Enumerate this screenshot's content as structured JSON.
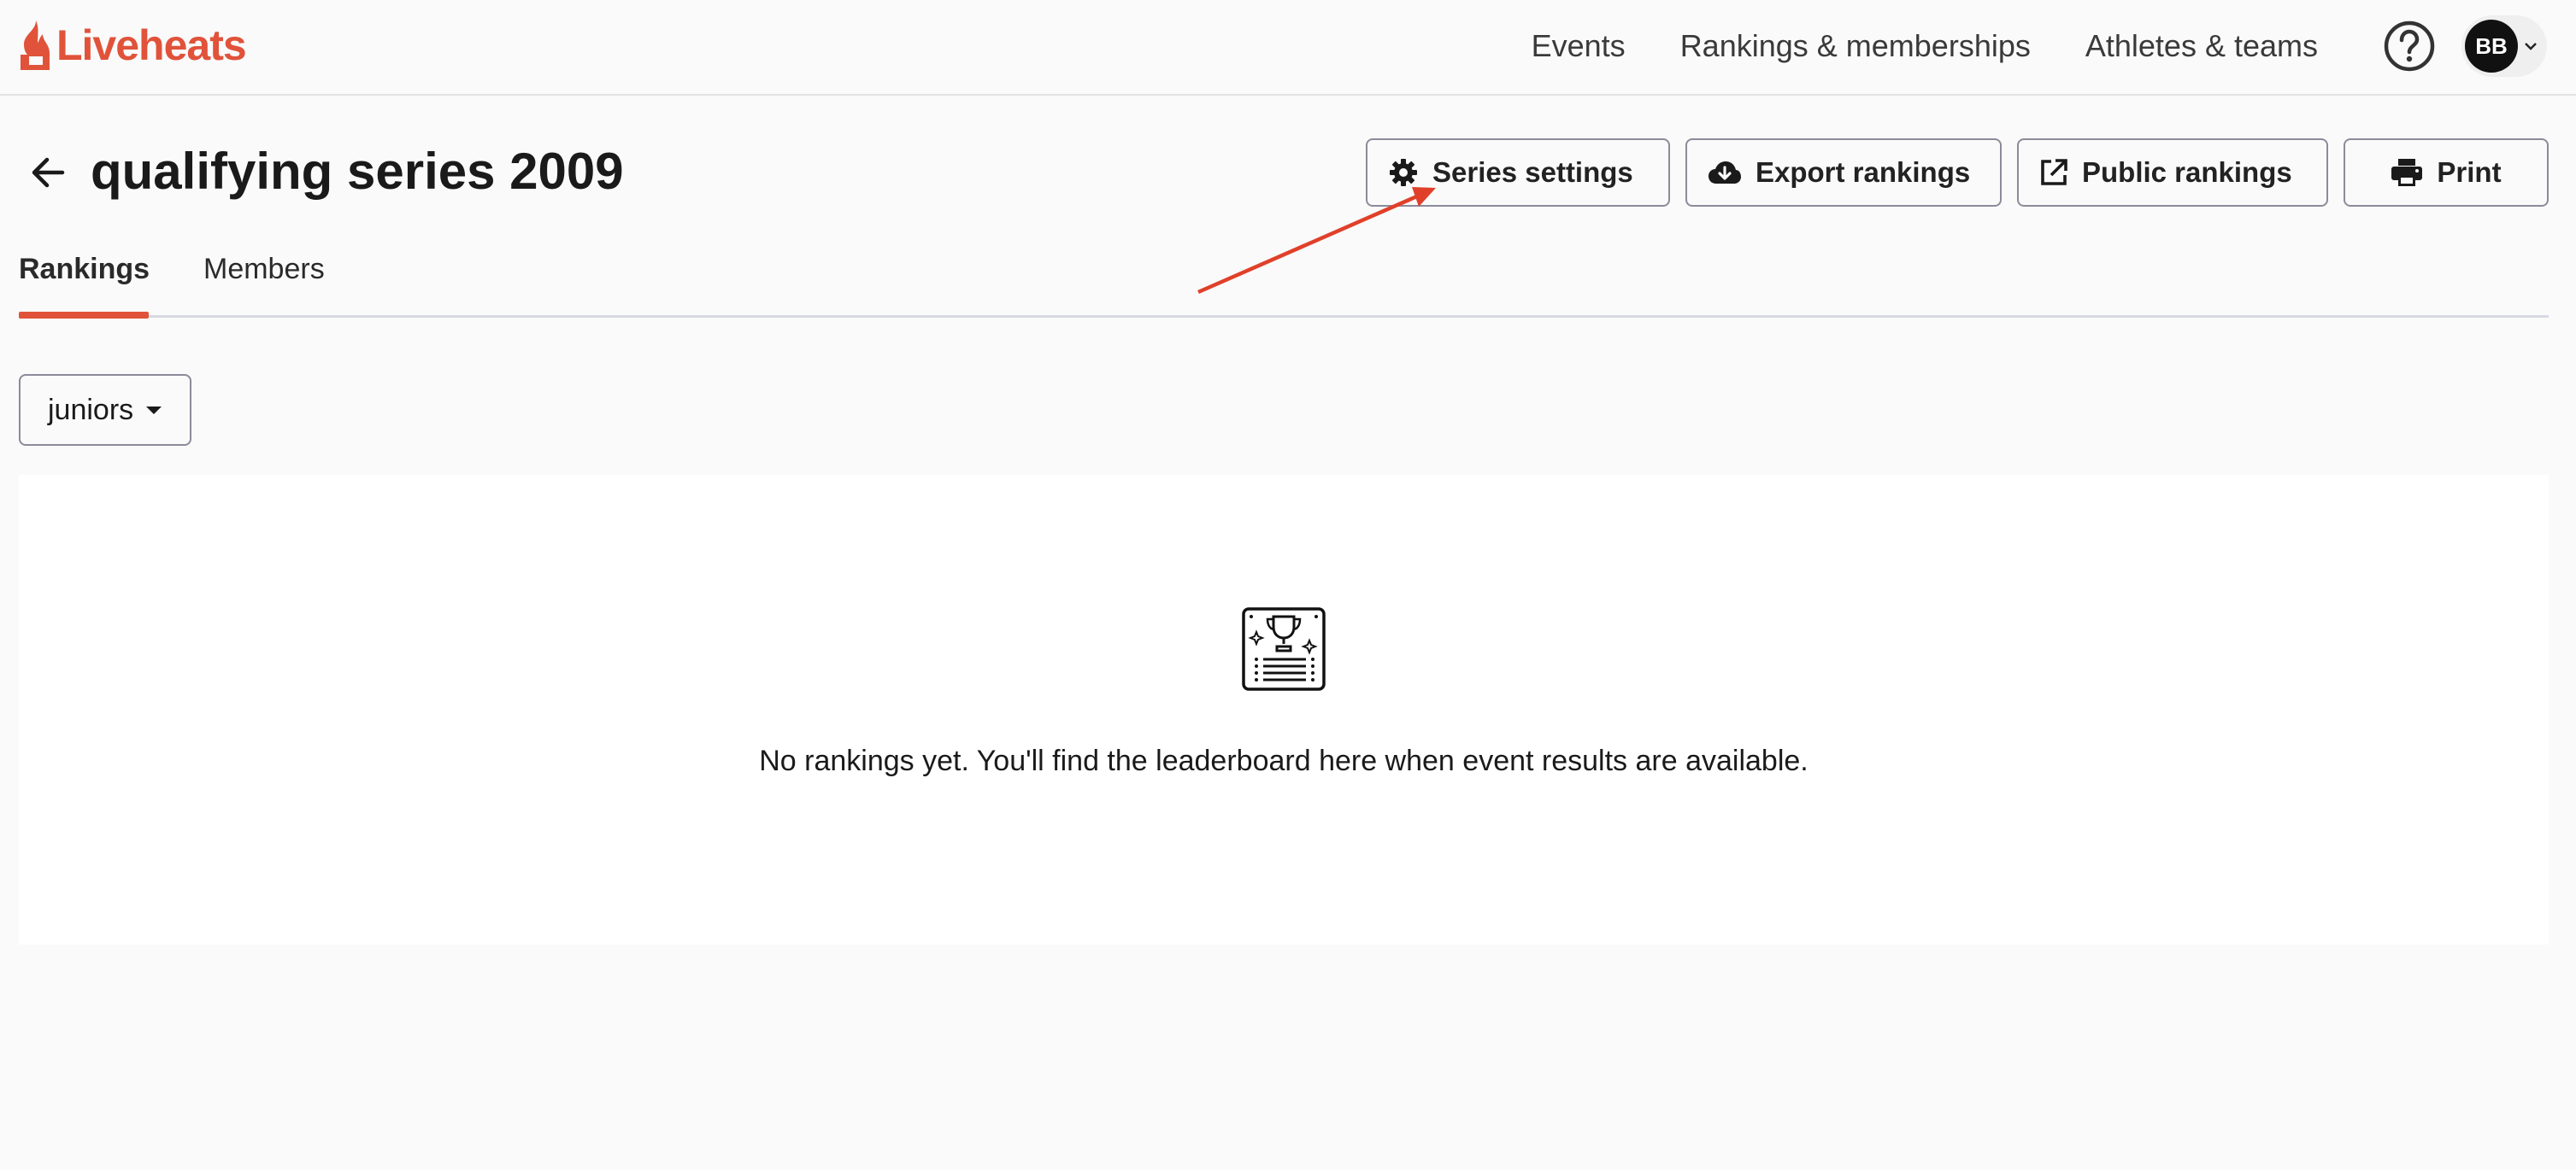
{
  "app": {
    "logo_text": "Liveheats",
    "brand_color": "#e0533a"
  },
  "nav": {
    "items": [
      {
        "label": "Events"
      },
      {
        "label": "Rankings & memberships"
      },
      {
        "label": "Athletes & teams"
      }
    ],
    "help_icon": "help-circle-icon",
    "avatar_initials": "BB"
  },
  "header": {
    "title": "qualifying series 2009",
    "actions": [
      {
        "label": "Series settings",
        "icon": "gear-icon"
      },
      {
        "label": "Export rankings",
        "icon": "cloud-download-icon"
      },
      {
        "label": "Public rankings",
        "icon": "external-link-icon"
      },
      {
        "label": "Print",
        "icon": "printer-icon"
      }
    ]
  },
  "tabs": [
    {
      "label": "Rankings",
      "active": true
    },
    {
      "label": "Members",
      "active": false
    }
  ],
  "division_select": {
    "value": "juniors"
  },
  "empty_state": {
    "icon": "trophy-leaderboard-icon",
    "message": "No rankings yet. You'll find the leaderboard here when event results are available."
  }
}
